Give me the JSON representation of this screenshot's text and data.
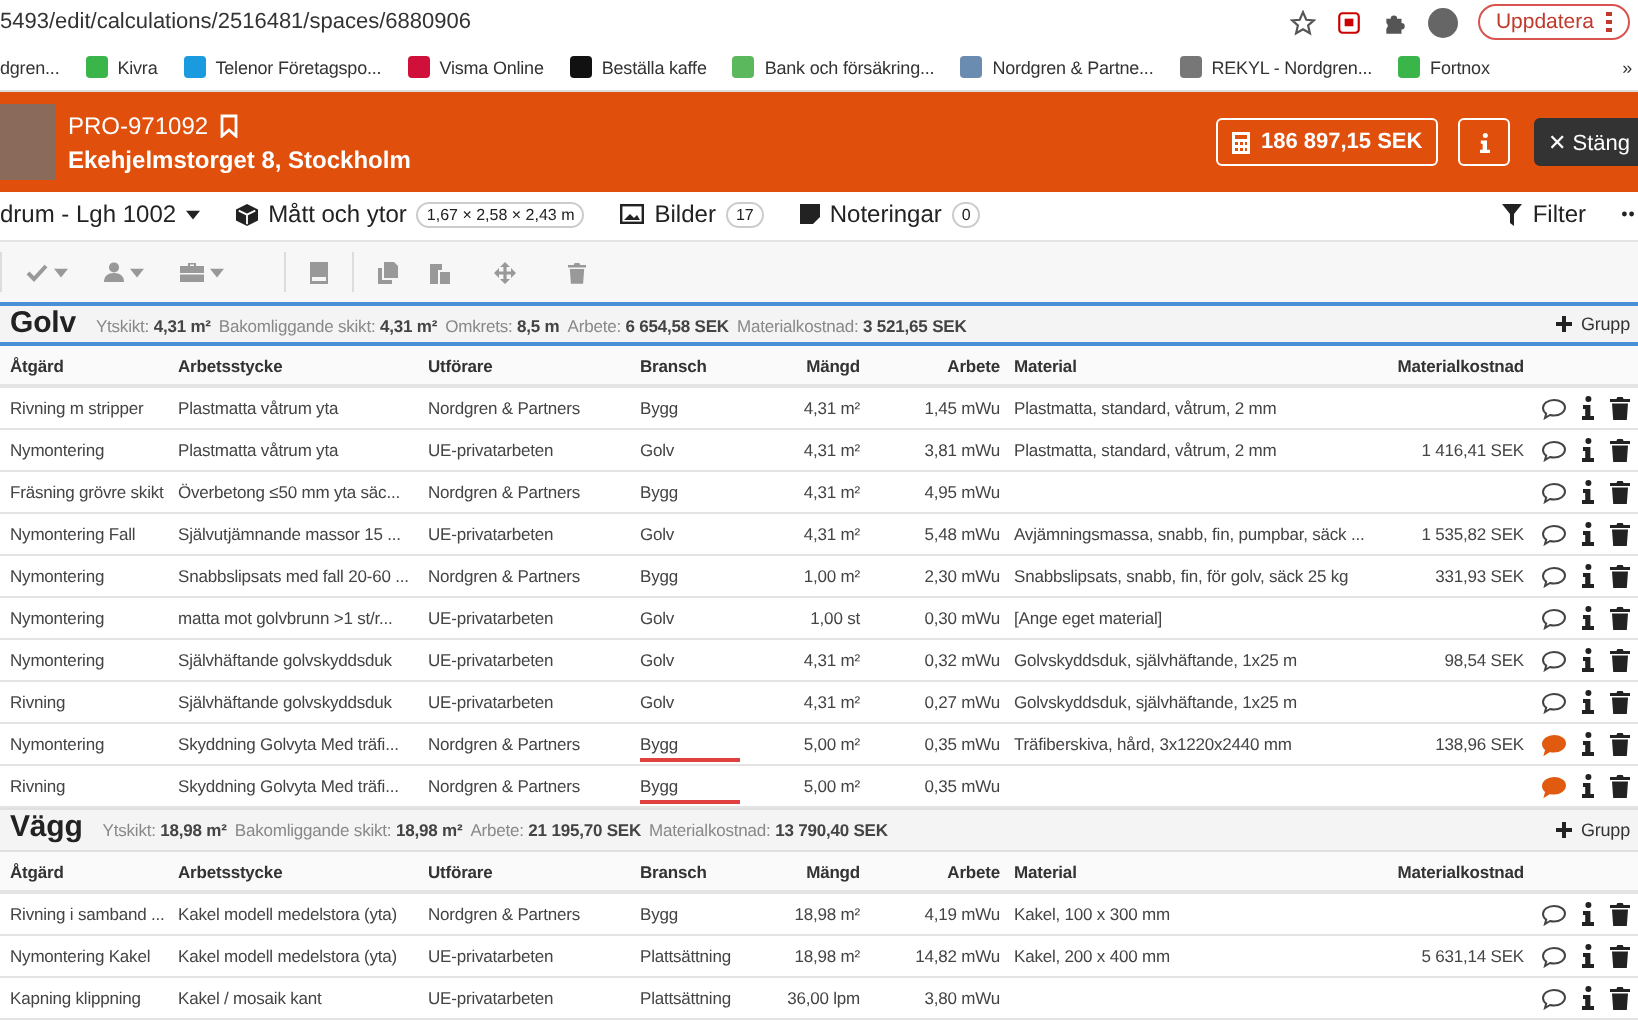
{
  "browser": {
    "url": "5493/edit/calculations/2516481/spaces/6880906",
    "update_button": "Uppdatera"
  },
  "bookmarks": {
    "items": [
      {
        "label": "dgren..."
      },
      {
        "label": "Kivra"
      },
      {
        "label": "Telenor Företagspo..."
      },
      {
        "label": "Visma Online"
      },
      {
        "label": "Beställa kaffe"
      },
      {
        "label": "Bank och försäkring..."
      },
      {
        "label": "Nordgren & Partne..."
      },
      {
        "label": "REKYL - Nordgren..."
      },
      {
        "label": "Fortnox"
      }
    ],
    "more": "»"
  },
  "header": {
    "project_id": "PRO-971092",
    "address": "Ekehjelmstorget 8, Stockholm",
    "total": "186 897,15 SEK",
    "close": "Stäng",
    "close_icon": "✕"
  },
  "tabs": {
    "space": "drum - Lgh 1002",
    "items": [
      {
        "kind": "dimensions",
        "label": "Mått och ytor",
        "badge": "1,67 × 2,58 × 2,43 m"
      },
      {
        "kind": "images",
        "label": "Bilder",
        "badge": "17"
      },
      {
        "kind": "notes",
        "label": "Noteringar",
        "badge": "0"
      }
    ],
    "filter": "Filter"
  },
  "sections": [
    {
      "title": "Golv",
      "selected": true,
      "add_group": "Grupp",
      "stats": [
        {
          "label": "Ytskikt:",
          "value": "4,31 m²"
        },
        {
          "label": "Bakomliggande skikt:",
          "value": "4,31 m²"
        },
        {
          "label": "Omkrets:",
          "value": "8,5 m"
        },
        {
          "label": "Arbete:",
          "value": "6 654,58 SEK"
        },
        {
          "label": "Materialkostnad:",
          "value": "3 521,65 SEK"
        }
      ],
      "columns": [
        "Åtgärd",
        "Arbetsstycke",
        "Utförare",
        "Bransch",
        "Mängd",
        "Arbete",
        "Material",
        "Materialkostnad"
      ],
      "rows": [
        {
          "cells": [
            "Rivning m stripper",
            "Plastmatta våtrum yta",
            "Nordgren & Partners",
            "Bygg",
            "4,31 m²",
            "1,45 mWu",
            "Plastmatta, standard, våtrum, 2 mm",
            ""
          ],
          "flagged": false,
          "has_comment": false
        },
        {
          "cells": [
            "Nymontering",
            "Plastmatta våtrum yta",
            "UE-privatarbeten",
            "Golv",
            "4,31 m²",
            "3,81 mWu",
            "Plastmatta, standard, våtrum, 2 mm",
            "1 416,41 SEK"
          ],
          "flagged": false,
          "has_comment": false
        },
        {
          "cells": [
            "Fräsning grövre skikt",
            "Överbetong ≤50 mm yta säc...",
            "Nordgren & Partners",
            "Bygg",
            "4,31 m²",
            "4,95 mWu",
            "",
            ""
          ],
          "flagged": false,
          "has_comment": false
        },
        {
          "cells": [
            "Nymontering Fall",
            "Självutjämnande massor 15 ...",
            "UE-privatarbeten",
            "Golv",
            "4,31 m²",
            "5,48 mWu",
            "Avjämningsmassa, snabb, fin, pumpbar, säck ...",
            "1 535,82 SEK"
          ],
          "flagged": false,
          "has_comment": false
        },
        {
          "cells": [
            "Nymontering",
            "Snabbslipsats med fall 20-60 ...",
            "Nordgren & Partners",
            "Bygg",
            "1,00 m²",
            "2,30 mWu",
            "Snabbslipsats, snabb, fin, för golv, säck 25 kg",
            "331,93 SEK"
          ],
          "flagged": false,
          "has_comment": false
        },
        {
          "cells": [
            "Nymontering",
            "matta mot golvbrunn >1 st/r...",
            "UE-privatarbeten",
            "Golv",
            "1,00 st",
            "0,30 mWu",
            "[Ange eget material]",
            ""
          ],
          "flagged": false,
          "has_comment": false
        },
        {
          "cells": [
            "Nymontering",
            "Självhäftande golvskyddsduk",
            "UE-privatarbeten",
            "Golv",
            "4,31 m²",
            "0,32 mWu",
            "Golvskyddsduk, självhäftande, 1x25 m",
            "98,54 SEK"
          ],
          "flagged": false,
          "has_comment": false
        },
        {
          "cells": [
            "Rivning",
            "Självhäftande golvskyddsduk",
            "UE-privatarbeten",
            "Golv",
            "4,31 m²",
            "0,27 mWu",
            "Golvskyddsduk, självhäftande, 1x25 m",
            ""
          ],
          "flagged": false,
          "has_comment": false
        },
        {
          "cells": [
            "Nymontering",
            "Skyddning Golvyta Med träfi...",
            "Nordgren & Partners",
            "Bygg",
            "5,00 m²",
            "0,35 mWu",
            "Träfiberskiva, hård, 3x1220x2440 mm",
            "138,96 SEK"
          ],
          "flagged": true,
          "has_comment": true
        },
        {
          "cells": [
            "Rivning",
            "Skyddning Golvyta Med träfi...",
            "Nordgren & Partners",
            "Bygg",
            "5,00 m²",
            "0,35 mWu",
            "",
            ""
          ],
          "flagged": true,
          "has_comment": true
        }
      ]
    },
    {
      "title": "Vägg",
      "selected": false,
      "add_group": "Grupp",
      "stats": [
        {
          "label": "Ytskikt:",
          "value": "18,98 m²"
        },
        {
          "label": "Bakomliggande skikt:",
          "value": "18,98 m²"
        },
        {
          "label": "Arbete:",
          "value": "21 195,70 SEK"
        },
        {
          "label": "Materialkostnad:",
          "value": "13 790,40 SEK"
        }
      ],
      "columns": [
        "Åtgärd",
        "Arbetsstycke",
        "Utförare",
        "Bransch",
        "Mängd",
        "Arbete",
        "Material",
        "Materialkostnad"
      ],
      "rows": [
        {
          "cells": [
            "Rivning i samband ...",
            "Kakel modell medelstora (yta)",
            "Nordgren & Partners",
            "Bygg",
            "18,98 m²",
            "4,19 mWu",
            "Kakel, 100 x 300 mm",
            ""
          ],
          "flagged": false,
          "has_comment": false
        },
        {
          "cells": [
            "Nymontering Kakel",
            "Kakel modell medelstora (yta)",
            "UE-privatarbeten",
            "Plattsättning",
            "18,98 m²",
            "14,82 mWu",
            "Kakel, 200 x 400 mm",
            "5 631,14 SEK"
          ],
          "flagged": false,
          "has_comment": false
        },
        {
          "cells": [
            "Kapning klippning",
            "Kakel / mosaik kant",
            "UE-privatarbeten",
            "Plattsättning",
            "36,00 lpm",
            "3,80 mWu",
            "",
            ""
          ],
          "flagged": false,
          "has_comment": false
        }
      ]
    }
  ]
}
